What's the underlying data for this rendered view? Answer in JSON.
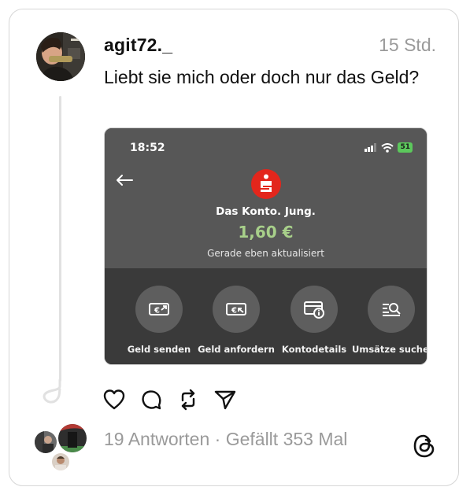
{
  "post": {
    "username": "agit72._",
    "time": "15 Std.",
    "text": "Liebt sie mich oder doch nur das Geld?"
  },
  "screenshot": {
    "status_time": "18:52",
    "battery": "51",
    "account_name": "Das Konto. Jung.",
    "balance": "1,60 €",
    "updated": "Gerade eben aktualisiert",
    "actions": [
      {
        "label": "Geld senden",
        "icon": "send-money-icon"
      },
      {
        "label": "Geld anfordern",
        "icon": "request-money-icon"
      },
      {
        "label": "Kontodetails",
        "icon": "account-details-icon"
      },
      {
        "label": "Umsätze suchen",
        "icon": "search-transactions-icon"
      }
    ],
    "colors": {
      "bank_logo": "#e3261c",
      "balance": "#a8d08a",
      "battery": "#5cc85c"
    }
  },
  "post_actions": [
    {
      "name": "like",
      "icon": "heart-icon"
    },
    {
      "name": "reply",
      "icon": "comment-icon"
    },
    {
      "name": "repost",
      "icon": "repost-icon"
    },
    {
      "name": "share",
      "icon": "send-icon"
    }
  ],
  "stats": {
    "text": "19 Antworten · Gefällt 353 Mal"
  },
  "brand": {
    "icon": "threads-logo-icon"
  }
}
